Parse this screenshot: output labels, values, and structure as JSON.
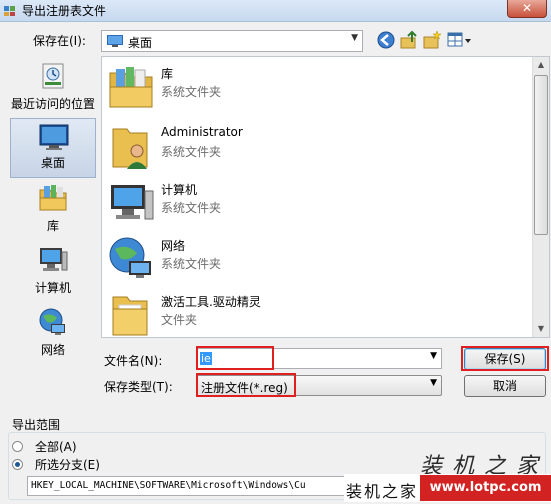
{
  "window": {
    "title": "导出注册表文件",
    "close_label": "✕"
  },
  "save_in": {
    "label": "保存在(I):",
    "value": "桌面"
  },
  "places": [
    {
      "label": "最近访问的位置",
      "icon": "recent-places-icon"
    },
    {
      "label": "桌面",
      "icon": "desktop-icon"
    },
    {
      "label": "库",
      "icon": "libraries-icon"
    },
    {
      "label": "计算机",
      "icon": "computer-icon"
    },
    {
      "label": "网络",
      "icon": "network-icon"
    }
  ],
  "files": [
    {
      "name": "库",
      "type": "系统文件夹",
      "icon": "libraries-icon"
    },
    {
      "name": "Administrator",
      "type": "系统文件夹",
      "icon": "user-folder-icon"
    },
    {
      "name": "计算机",
      "type": "系统文件夹",
      "icon": "computer-icon"
    },
    {
      "name": "网络",
      "type": "系统文件夹",
      "icon": "network-icon"
    },
    {
      "name": "激活工具.驱动精灵",
      "type": "文件夹",
      "icon": "folder-icon"
    }
  ],
  "filename": {
    "label": "文件名(N):",
    "value": "ie"
  },
  "filetype": {
    "label": "保存类型(T):",
    "value": "注册文件(*.reg)"
  },
  "buttons": {
    "save": "保存(S)",
    "cancel": "取消"
  },
  "export_range": {
    "label": "导出范围",
    "all_label": "全部(A)",
    "branch_label": "所选分支(E)",
    "branch_path": "HKEY_LOCAL_MACHINE\\SOFTWARE\\Microsoft\\Windows\\Cu",
    "selected": "branch"
  },
  "watermark": {
    "top": "装机之家",
    "left": "装机之家",
    "url": "www.lotpc.com"
  },
  "colors": {
    "highlight": "#e02020",
    "selection": "#3399ff"
  }
}
